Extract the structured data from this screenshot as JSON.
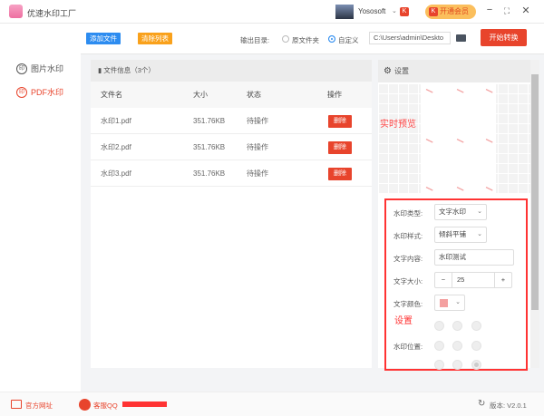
{
  "app": {
    "title": "优速水印工厂",
    "username": "Yososoft",
    "vip_label": "开通会员"
  },
  "sidebar": {
    "items": [
      {
        "label": "图片水印",
        "icon": "印"
      },
      {
        "label": "PDF水印",
        "icon": "印"
      }
    ]
  },
  "toolbar": {
    "add_files": "添加文件",
    "clear_list": "清除列表",
    "output_label": "输出目录:",
    "opt_original": "原文件夹",
    "opt_custom": "自定义",
    "path": "C:\\Users\\admin\\Deskto",
    "start": "开始转换"
  },
  "list": {
    "header": "文件信息（3个）",
    "columns": [
      "文件名",
      "大小",
      "状态",
      "操作"
    ],
    "rows": [
      {
        "name": "水印1.pdf",
        "size": "351.76KB",
        "status": "待操作",
        "action": "删除"
      },
      {
        "name": "水印2.pdf",
        "size": "351.76KB",
        "status": "待操作",
        "action": "删除"
      },
      {
        "name": "水印3.pdf",
        "size": "351.76KB",
        "status": "待操作",
        "action": "删除"
      }
    ]
  },
  "settings": {
    "header": "设置",
    "preview_label": "实时预览",
    "wm_type_label": "水印类型:",
    "wm_type": "文字水印",
    "wm_style_label": "水印样式:",
    "wm_style": "倾斜平铺",
    "text_label": "文字内容:",
    "text": "水印测试",
    "size_label": "文字大小:",
    "size": "25",
    "color_label": "文字颜色:",
    "settings_annotation": "设置",
    "position_label": "水印位置:",
    "position_selected": "bottom-right",
    "text_color": "#f4a0a0"
  },
  "footer": {
    "website": "官方网址",
    "qq": "客服QQ",
    "version": "版本: V2.0.1"
  }
}
